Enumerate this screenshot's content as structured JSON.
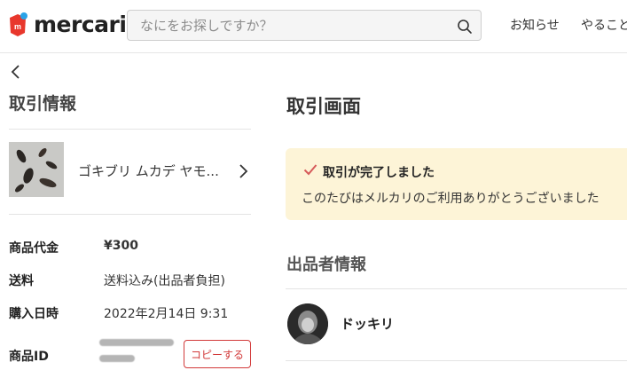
{
  "header": {
    "logo_text": "mercari",
    "search_placeholder": "なにをお探しですか？",
    "nav": [
      "お知らせ",
      "やること"
    ]
  },
  "left": {
    "title": "取引情報",
    "product_name": "ゴキブリ ムカデ ヤモ...",
    "details": {
      "price_label": "商品代金",
      "price_value": "¥300",
      "shipping_label": "送料",
      "shipping_value": "送料込み(出品者負担)",
      "date_label": "購入日時",
      "date_value": "2022年2月14日 9:31",
      "id_label": "商品ID",
      "copy_label": "コピーする"
    }
  },
  "right": {
    "title": "取引画面",
    "notice_title": "取引が完了しました",
    "notice_body": "このたびはメルカリのご利用ありがとうございました",
    "seller_title": "出品者情報",
    "seller_name": "ドッキリ"
  },
  "colors": {
    "brand_red": "#d23a3a",
    "notice_bg": "#fdf4d7",
    "check": "#d65a5a"
  },
  "icons": [
    "mercari-logo-icon",
    "search-icon",
    "back-arrow-icon",
    "chevron-right-icon",
    "check-icon"
  ]
}
